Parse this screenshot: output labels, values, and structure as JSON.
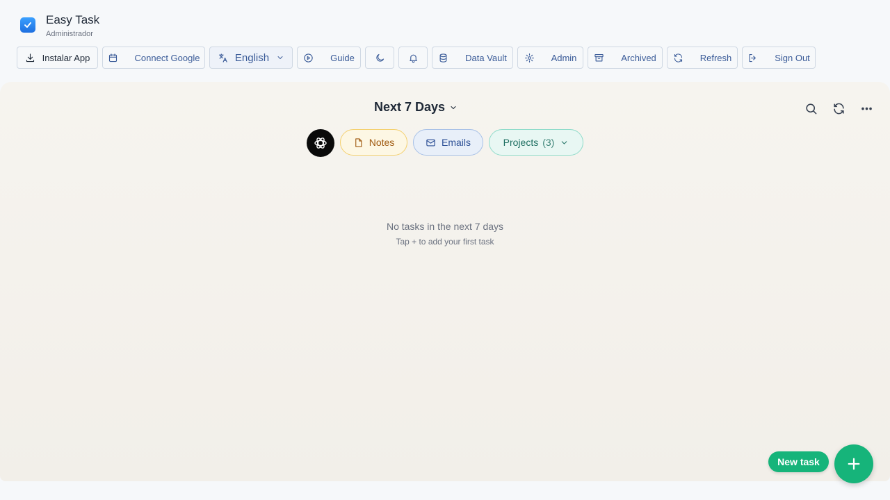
{
  "app": {
    "title": "Easy Task",
    "subtitle": "Administrador",
    "logo_icon": "checkbox-icon",
    "accent": "#1e6fe0"
  },
  "toolbar": {
    "install": "Instalar App",
    "connect_google": "Connect Google",
    "language": "English",
    "guide": "Guide",
    "data_vault": "Data Vault",
    "admin": "Admin",
    "archived": "Archived",
    "refresh": "Refresh",
    "sign_out": "Sign Out"
  },
  "view": {
    "title": "Next 7 Days"
  },
  "filters": {
    "notes": "Notes",
    "emails": "Emails",
    "projects": "Projects",
    "projects_count": "(3)"
  },
  "empty_state": {
    "title": "No tasks in the next 7 days",
    "subtitle": "Tap + to add your first task"
  },
  "actions": {
    "new_task": "New task",
    "fab_color": "#16b47a"
  }
}
